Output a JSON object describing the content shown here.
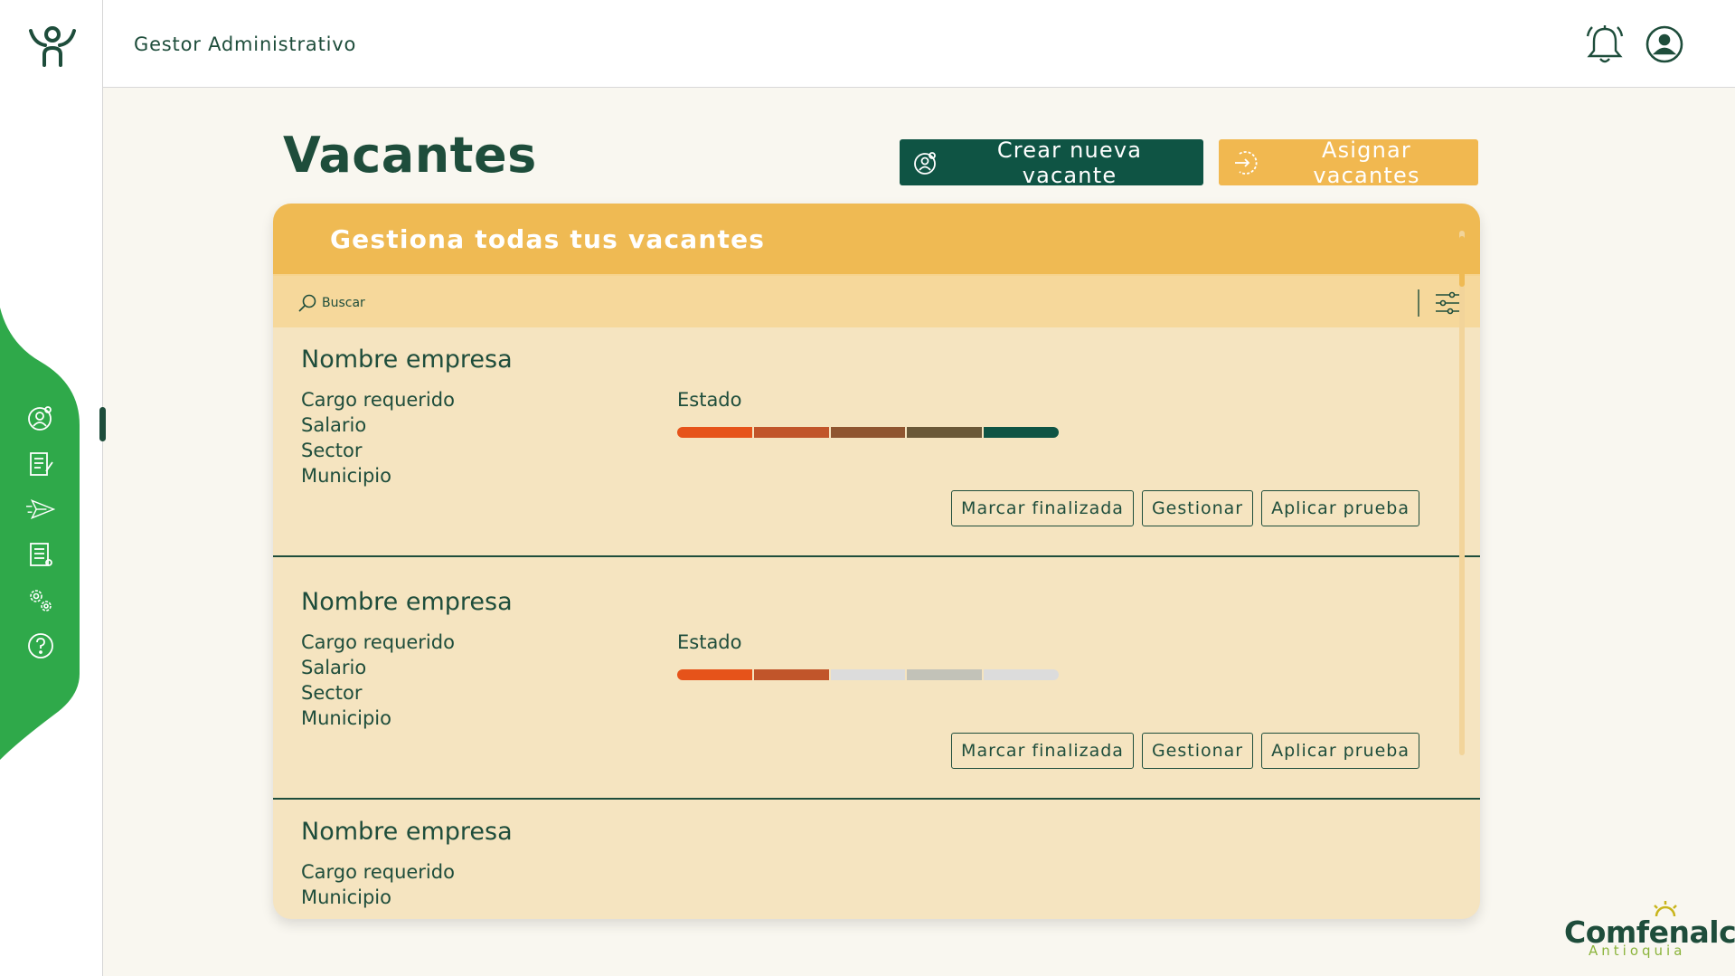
{
  "header": {
    "app_title": "Gestor Administrativo",
    "icons": [
      "bell-icon",
      "user-profile-icon"
    ]
  },
  "sidebar": {
    "logo": "people-logo-icon",
    "items": [
      {
        "icon": "user-settings-icon"
      },
      {
        "icon": "document-edit-icon"
      },
      {
        "icon": "send-icon"
      },
      {
        "icon": "document-list-icon"
      },
      {
        "icon": "gears-icon"
      },
      {
        "icon": "help-icon"
      }
    ]
  },
  "page": {
    "title": "Vacantes",
    "create_button": "Crear nueva vacante",
    "assign_button": "Asignar vacantes"
  },
  "panel": {
    "title": "Gestiona todas tus vacantes",
    "search_placeholder": "Buscar"
  },
  "vacancies": [
    {
      "company": "Nombre empresa",
      "fields": [
        "Cargo requerido",
        "Salario",
        "Sector",
        "Municipio"
      ],
      "status_label": "Estado",
      "status_steps_completed": 5,
      "buttons": [
        "Marcar finalizada",
        "Gestionar",
        "Aplicar prueba"
      ]
    },
    {
      "company": "Nombre empresa",
      "fields": [
        "Cargo requerido",
        "Salario",
        "Sector",
        "Municipio"
      ],
      "status_label": "Estado",
      "status_steps_completed": 2,
      "buttons": [
        "Marcar finalizada",
        "Gestionar",
        "Aplicar prueba"
      ]
    },
    {
      "company": "Nombre empresa",
      "fields": [
        "Cargo requerido",
        "Municipio"
      ]
    }
  ],
  "status_colors": {
    "complete": [
      "#e6531a",
      "#c1552a",
      "#8f5530",
      "#6a5838",
      "#0f5444"
    ],
    "pending": [
      "#dcdcdc",
      "#c2c2b8",
      "#dcdcdc"
    ]
  },
  "brand": {
    "name": "Comfenalco",
    "region": "Antioquia"
  },
  "colors": {
    "primary": "#1e4d3b",
    "accent": "#efba53",
    "sidebar_green": "#2fa94a",
    "panel_bg": "#f5e4c0"
  }
}
